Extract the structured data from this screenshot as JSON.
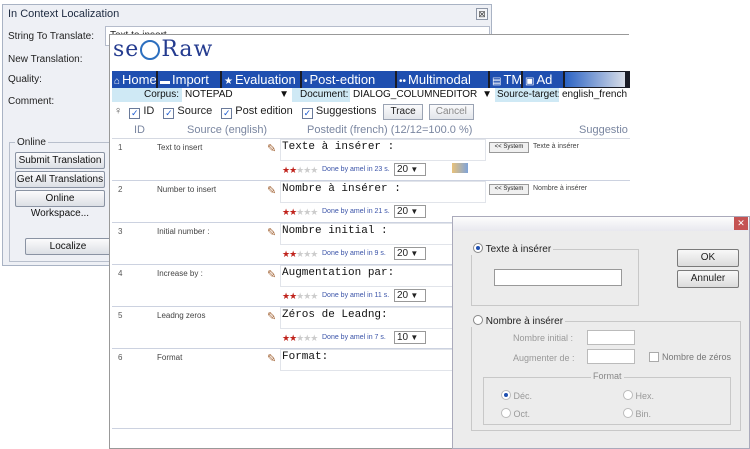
{
  "loc_window": {
    "title": "In Context Localization",
    "close_label": "⊠",
    "string_to_translate_label": "String To Translate:",
    "string_to_translate_value": "Text to insert",
    "new_translation_label": "New Translation:",
    "quality_label": "Quality:",
    "comment_label": "Comment:",
    "online_label": "Online",
    "submit_button": "Submit Translation",
    "get_all_button": "Get All Translations",
    "workspace_button": "Online Workspace...",
    "localize_button": "Localize"
  },
  "translator": {
    "logo_text_left": "se",
    "logo_text_right": "Raw",
    "toolbar": [
      {
        "label": "Home",
        "icon": "home-icon",
        "glyph": "⌂"
      },
      {
        "label": "Import",
        "icon": "import-icon",
        "glyph": "▬"
      },
      {
        "label": "Evaluation",
        "icon": "star-icon",
        "glyph": "★"
      },
      {
        "label": "Post-edtion",
        "icon": "post-edition-icon",
        "glyph": "•"
      },
      {
        "label": "Multimodal",
        "icon": "multimodal-icon",
        "glyph": "••"
      },
      {
        "label": "TM",
        "icon": "tm-icon",
        "glyph": "▤"
      },
      {
        "label": "Ad",
        "icon": "admin-icon",
        "glyph": "▣"
      }
    ],
    "corpus_label": "Corpus:",
    "corpus_value": "NOTEPAD",
    "document_label": "Document:",
    "document_value": "DIALOG_COLUMNEDITOR",
    "source_target_label": "Source-target:",
    "source_target_value": "english_french",
    "filters": {
      "id": "ID",
      "source": "Source",
      "post_edition": "Post edition",
      "suggestions": "Suggestions",
      "trace_button": "Trace",
      "cancel_button": "Cancel"
    },
    "columns": {
      "id": "ID",
      "source": "Source (english)",
      "postedit": "Postedit (french) (12/12=100.0 %)",
      "suggestions": "Suggestio"
    },
    "rows": [
      {
        "id": "1",
        "source": "Text to insert",
        "postedit": "Texte à insérer :",
        "done": "Done by amel in 23 s.",
        "rating": "20",
        "system_button": "<< System",
        "suggestion": "Texte à insérer"
      },
      {
        "id": "2",
        "source": "Number to insert",
        "postedit": "Nombre à insérer :",
        "done": "Done by amel in 21 s.",
        "rating": "20",
        "system_button": "<< System",
        "suggestion": "Nombre à insérer"
      },
      {
        "id": "3",
        "source": "Initial number :",
        "postedit": "Nombre initial :",
        "done": "Done by amel in 9 s.",
        "rating": "20",
        "system_button": "",
        "suggestion": ""
      },
      {
        "id": "4",
        "source": "Increase by :",
        "postedit": "Augmentation par:",
        "done": "Done by amel in 11 s.",
        "rating": "20",
        "system_button": "",
        "suggestion": ""
      },
      {
        "id": "5",
        "source": "Leadng zeros",
        "postedit": "Zéros de Leadng:",
        "done": "Done by amel in 7 s.",
        "rating": "10",
        "system_button": "",
        "suggestion": ""
      },
      {
        "id": "6",
        "source": "Format",
        "postedit": "Format:",
        "done": "",
        "rating": "",
        "system_button": "",
        "suggestion": ""
      }
    ]
  },
  "dialog": {
    "close_label": "✕",
    "insert_text_label": "Texte à insérer",
    "insert_number_label": "Nombre à insérer",
    "initial_number_label": "Nombre initial :",
    "increase_by_label": "Augmenter de :",
    "leading_zeros_label": "Nombre de zéros",
    "format_label": "Format",
    "format_options": [
      "Déc.",
      "Hex.",
      "Oct.",
      "Bin."
    ],
    "ok_button": "OK",
    "cancel_button": "Annuler"
  }
}
